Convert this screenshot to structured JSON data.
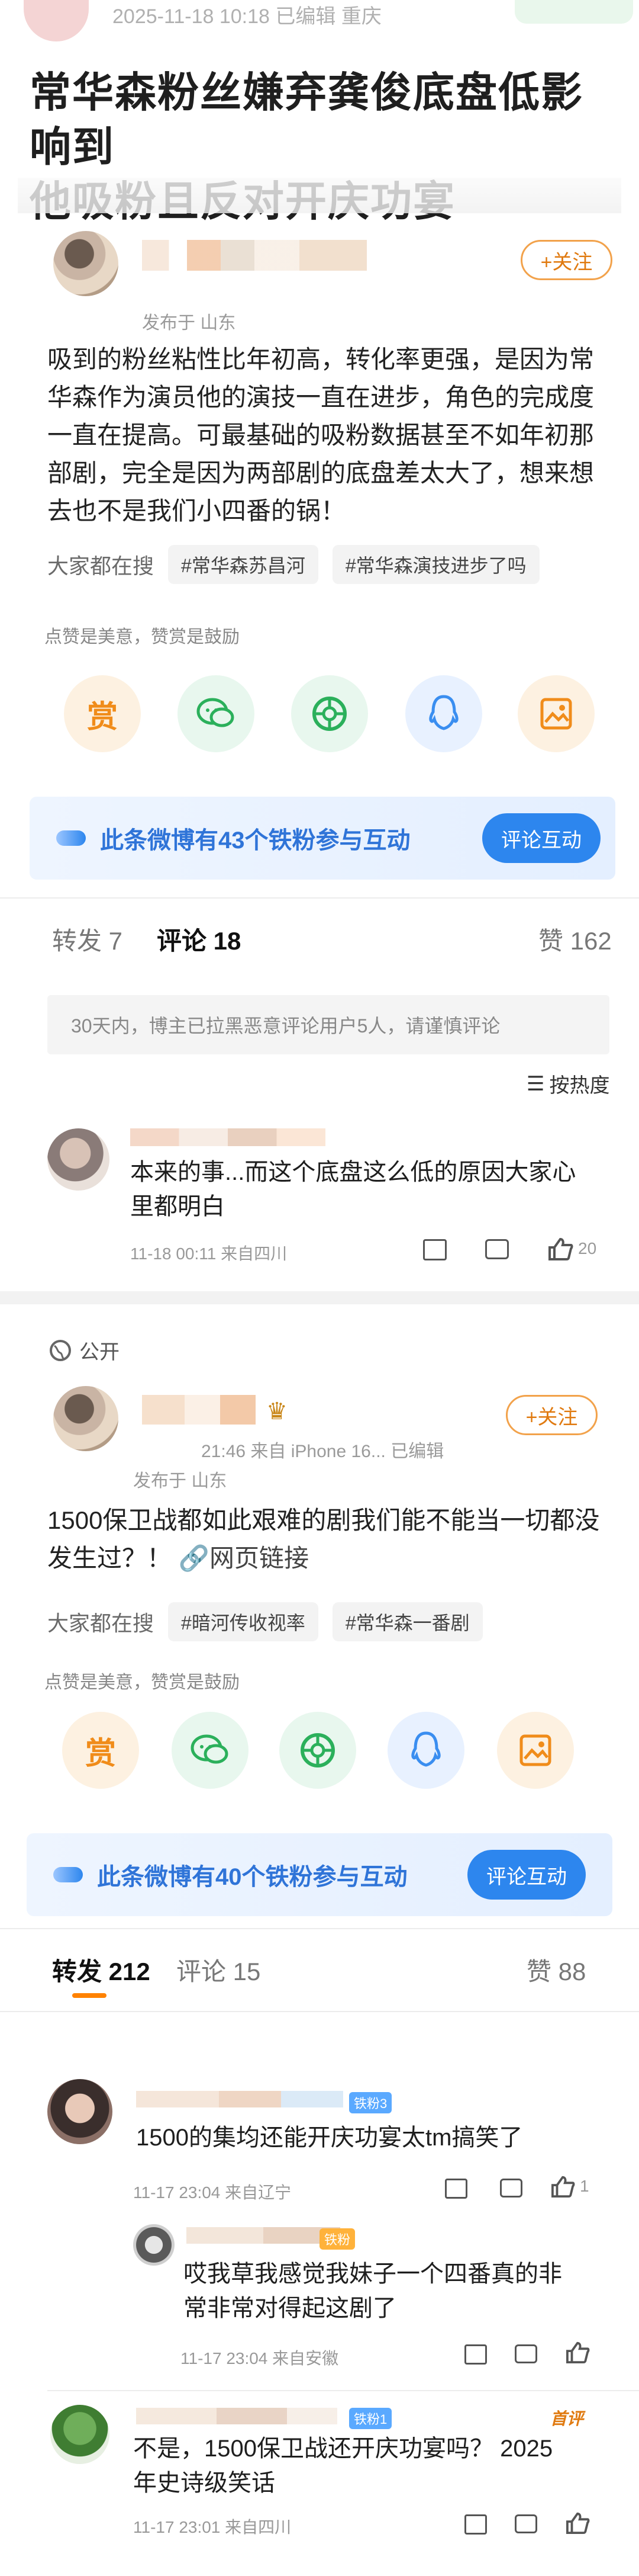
{
  "top": {
    "date": "2025-11-18 10:18  已编辑  重庆"
  },
  "headline": {
    "line1": "常华森粉丝嫌弃龚俊底盘低影响到",
    "line2": "他吸粉且反对开庆功宴"
  },
  "post1": {
    "location": "发布于 山东",
    "follow": "+关注",
    "text": "吸到的粉丝粘性比年初高，转化率更强，是因为常华森作为演员他的演技一直在进步，角色的完成度一直在提高。可最基础的吸粉数据甚至不如年初那部剧，完全是因为两部剧的底盘差太大了，想来想去也不是我们小四番的锅！",
    "search_label": "大家都在搜",
    "tags": [
      "#常华森苏昌河",
      "#常华森演技进步了吗"
    ],
    "reward_caption": "点赞是美意，赞赏是鼓励",
    "reward_icon": "赏",
    "fan_banner": "此条微博有43个铁粉参与互动",
    "fan_button": "评论互动",
    "tabs": {
      "repost": "转发 7",
      "comment": "评论 18",
      "like": "赞 162"
    },
    "notice": "30天内，博主已拉黑恶意评论用户5人，请谨慎评论",
    "sort": "按热度",
    "comment": {
      "text_line1": "本来的事...而这个底盘这么低的原因大家心",
      "text_line2": "里都明白",
      "meta": "11-18 00:11  来自四川",
      "likes": "20"
    }
  },
  "post2": {
    "visibility": "公开",
    "meta": "21:46  来自 iPhone 16...  已编辑",
    "location": "发布于 山东",
    "follow": "+关注",
    "text_line1": "1500保卫战都如此艰难的剧我们能不能当一切都没",
    "text_line2": "发生过？！",
    "link": "网页链接",
    "search_label": "大家都在搜",
    "tags": [
      "#暗河传收视率",
      "#常华森一番剧"
    ],
    "reward_caption": "点赞是美意，赞赏是鼓励",
    "reward_icon": "赏",
    "fan_banner": "此条微博有40个铁粉参与互动",
    "fan_button": "评论互动",
    "tabs": {
      "repost": "转发 212",
      "comment": "评论 15",
      "like": "赞 88"
    },
    "comments": [
      {
        "text": "1500的集均还能开庆功宴太tm搞笑了",
        "meta": "11-17 23:04  来自辽宁",
        "likes": "1",
        "badge": "铁粉3"
      },
      {
        "text_line1": "哎我草我感觉我妹子一个四番真的非",
        "text_line2": "常非常对得起这剧了",
        "meta": "11-17 23:04  来自安徽",
        "badge": "铁粉"
      },
      {
        "text_line1": "不是，1500保卫战还开庆功宴吗？ 2025",
        "text_line2": "年史诗级笑话",
        "meta": "11-17 23:01  来自四川",
        "badge": "铁粉1",
        "tag": "首评"
      }
    ]
  }
}
